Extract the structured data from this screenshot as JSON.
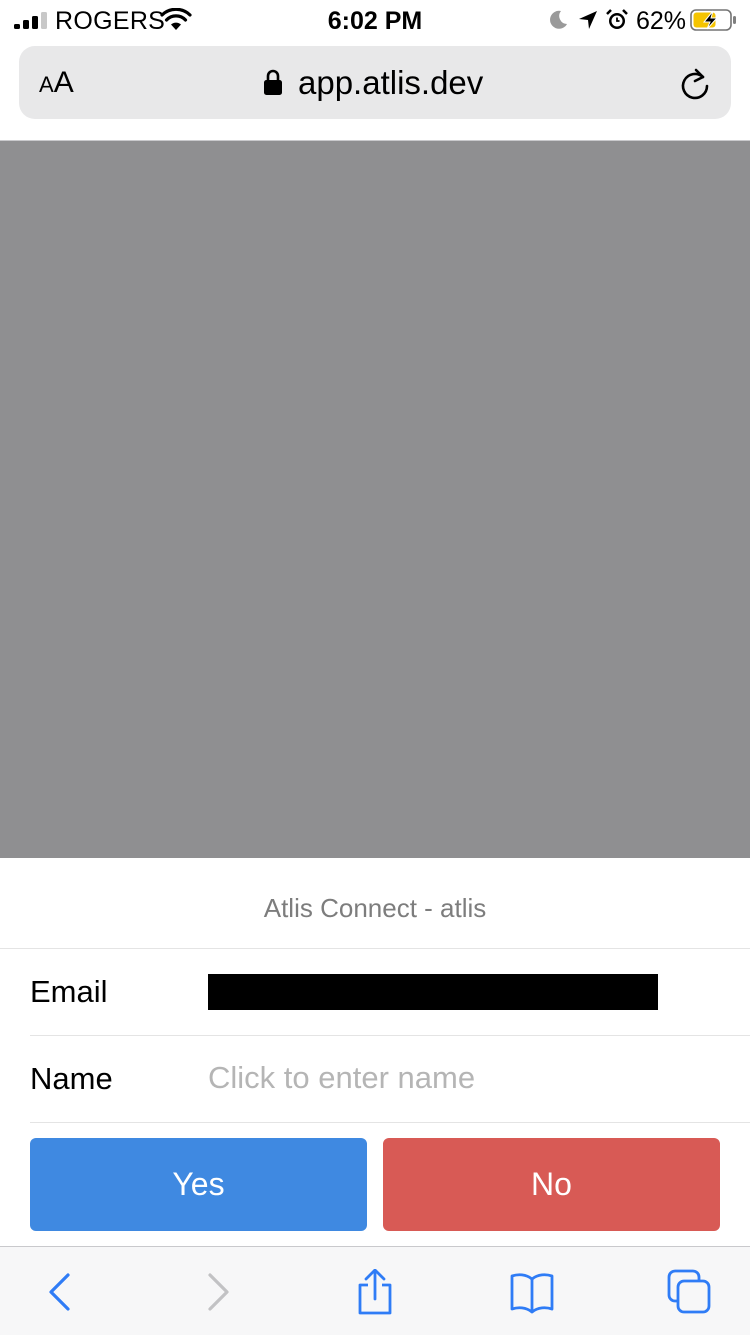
{
  "status_bar": {
    "carrier": "ROGERS",
    "time": "6:02 PM",
    "battery_percent": "62%",
    "icons": [
      "signal-icon",
      "wifi-icon",
      "moon-icon",
      "location-icon",
      "alarm-icon",
      "battery-charging-icon"
    ]
  },
  "address_bar": {
    "text_size_label_small": "A",
    "text_size_label_large": "A",
    "url": "app.atlis.dev",
    "icons": [
      "lock-icon",
      "reload-icon"
    ]
  },
  "sheet": {
    "title": "Atlis Connect - atlis",
    "email_label": "Email",
    "name_label": "Name",
    "name_placeholder": "Click to enter name",
    "name_value": "",
    "yes_label": "Yes",
    "no_label": "No"
  },
  "toolbar": {
    "icons": [
      "back-icon",
      "forward-icon",
      "share-icon",
      "bookmarks-icon",
      "tabs-icon"
    ]
  },
  "colors": {
    "yes_button": "#3f89e1",
    "no_button": "#d85a55",
    "overlay": "#8f8f91",
    "toolbar_accent": "#2f7cf6",
    "disabled_icon": "#c2c2c4"
  }
}
